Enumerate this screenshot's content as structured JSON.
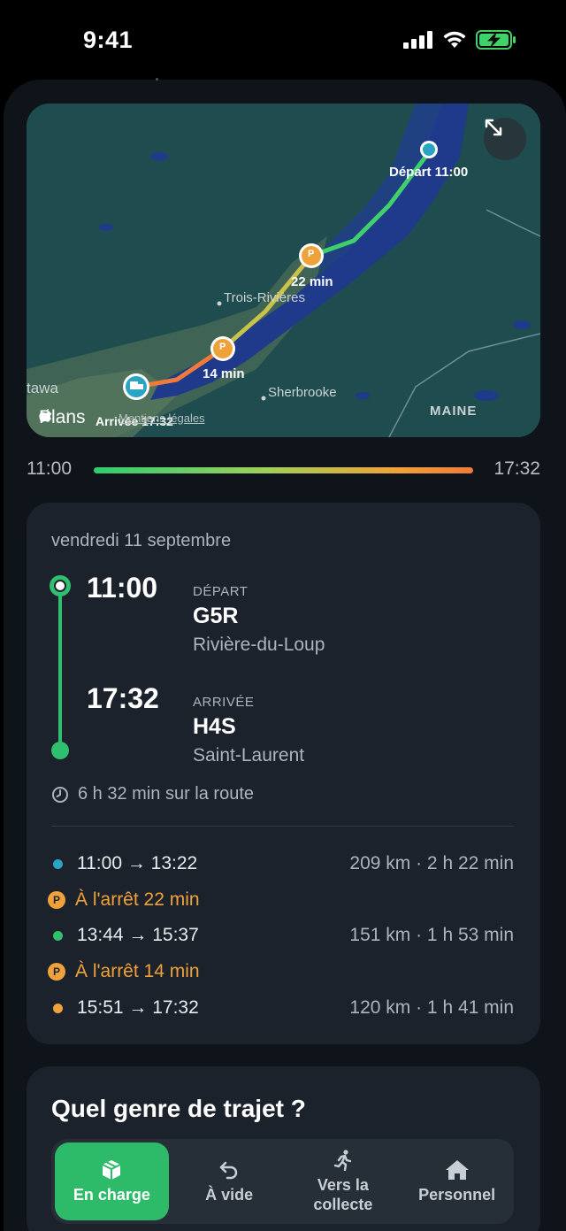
{
  "status_bar": {
    "time": "9:41"
  },
  "map": {
    "departure_label": "Départ 11:00",
    "arrival_label": "Arrivée 17:32",
    "stop1_duration": "22 min",
    "stop2_duration": "14 min",
    "stop_badge": "P",
    "places": [
      "Trois-Rivières",
      "Sherbrooke",
      "MAINE",
      "tawa"
    ],
    "attribution": "Plans",
    "legal": "Mentions légales",
    "expand_icon": "expand-arrows-icon"
  },
  "progress": {
    "start": "11:00",
    "end": "17:32"
  },
  "trip": {
    "date": "vendredi 11 septembre",
    "departure": {
      "time": "11:00",
      "kind": "DÉPART",
      "code": "G5R",
      "city": "Rivière-du-Loup"
    },
    "arrival": {
      "time": "17:32",
      "kind": "ARRIVÉE",
      "code": "H4S",
      "city": "Saint-Laurent"
    },
    "duration": "6 h 32 min sur la route",
    "segments": [
      {
        "range": "11:00 → 13:22",
        "meta": "209 km · 2 h 22 min",
        "color": "#2ba3c4"
      },
      {
        "range": "13:44 → 15:37",
        "meta": "151 km · 1 h 53 min",
        "color": "#2fbf6e"
      },
      {
        "range": "15:51 → 17:32",
        "meta": "120 km · 1 h 41 min",
        "color": "#f0a23a"
      }
    ],
    "pauses": [
      {
        "badge": "P",
        "text": "À l'arrêt 22 min"
      },
      {
        "badge": "P",
        "text": "À l'arrêt 14 min"
      }
    ]
  },
  "trip_type": {
    "question": "Quel genre de trajet ?",
    "options": [
      {
        "label": "En charge",
        "icon": "package-icon",
        "selected": true
      },
      {
        "label": "À vide",
        "icon": "return-arrow-icon",
        "selected": false
      },
      {
        "label": "Vers la\ncollecte",
        "icon": "running-person-icon",
        "selected": false
      },
      {
        "label": "Personnel",
        "icon": "house-icon",
        "selected": false
      }
    ]
  },
  "colors": {
    "accent": "#2dbb6a",
    "orange": "#f0a23a",
    "blue": "#2ba3c4"
  }
}
